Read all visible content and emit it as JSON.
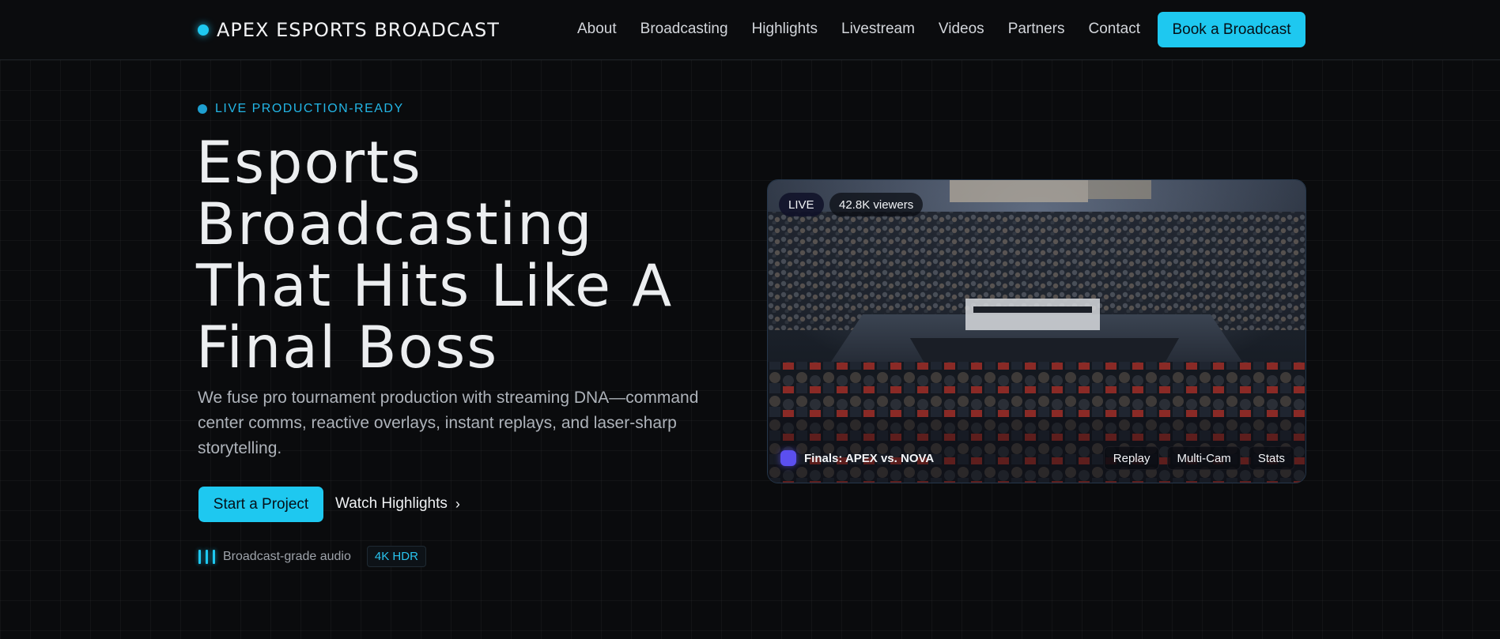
{
  "brand": {
    "name": "APEX ESPORTS BROADCAST"
  },
  "nav": {
    "items": [
      "About",
      "Broadcasting",
      "Highlights",
      "Livestream",
      "Videos",
      "Partners",
      "Contact"
    ],
    "cta": "Book a Broadcast"
  },
  "hero": {
    "eyebrow": "LIVE PRODUCTION-READY",
    "headline_lines": [
      "Esports",
      "Broadcasting",
      "That Hits Like A",
      "Final Boss"
    ],
    "subcopy": "We fuse pro tournament production with streaming DNA—command center comms, reactive overlays, instant replays, and laser-sharp storytelling.",
    "primary_cta": "Start a Project",
    "secondary_cta": "Watch Highlights",
    "meta_audio": "Broadcast-grade audio",
    "meta_badge": "4K HDR"
  },
  "stream": {
    "live_label": "LIVE",
    "viewers": "42.8K viewers",
    "match_title": "Finals: APEX vs. NOVA",
    "controls": [
      "Replay",
      "Multi-Cam",
      "Stats"
    ]
  },
  "colors": {
    "accent": "#1ec8f0",
    "background": "#0a0b0d",
    "match_icon": "#5b4ff0"
  },
  "icons": {
    "brand": "live-dot-icon",
    "eyebrow": "status-dot-icon",
    "chevron": "chevron-right-icon",
    "audio": "audio-bars-icon",
    "match": "team-logo-icon"
  }
}
